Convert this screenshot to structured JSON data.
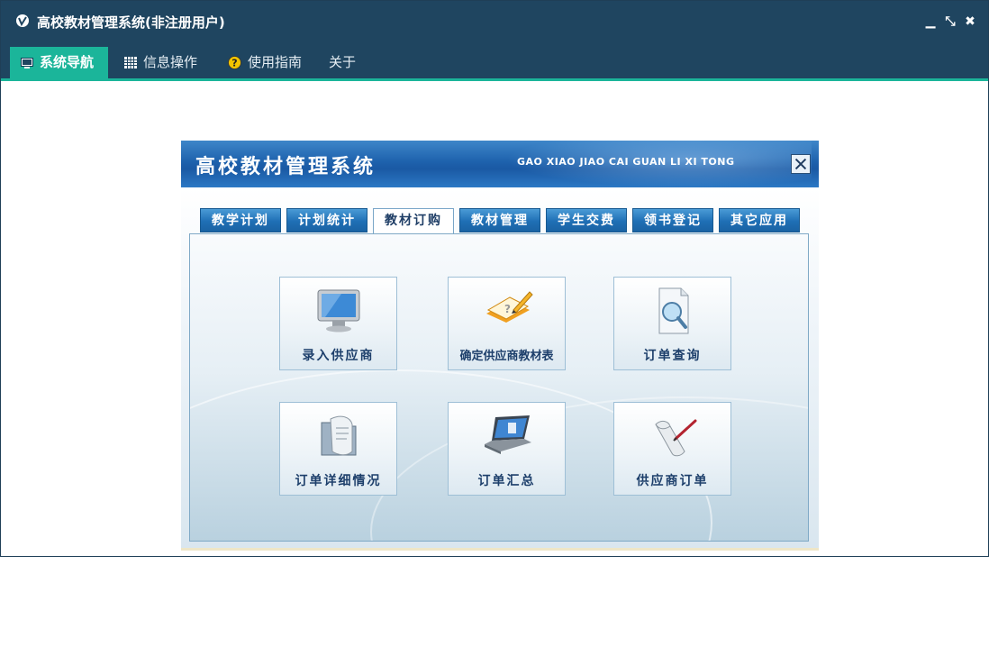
{
  "window": {
    "title": "高校教材管理系统(非注册用户)",
    "controls": {
      "minimize": "▁",
      "restore": "⤡",
      "close": "✖"
    }
  },
  "menubar": {
    "items": [
      {
        "label": "系统导航",
        "icon": "monitor-icon",
        "active": true
      },
      {
        "label": "信息操作",
        "icon": "grid-icon",
        "active": false
      },
      {
        "label": "使用指南",
        "icon": "help-icon",
        "active": false
      },
      {
        "label": "关于",
        "icon": "",
        "active": false
      }
    ]
  },
  "inner": {
    "title": "高校教材管理系统",
    "subtitle": "GAO XIAO JIAO CAI GUAN LI XI TONG",
    "tabs": [
      {
        "label": "教学计划",
        "active": false
      },
      {
        "label": "计划统计",
        "active": false
      },
      {
        "label": "教材订购",
        "active": true
      },
      {
        "label": "教材管理",
        "active": false
      },
      {
        "label": "学生交费",
        "active": false
      },
      {
        "label": "领书登记",
        "active": false
      },
      {
        "label": "其它应用",
        "active": false
      }
    ],
    "buttons": [
      {
        "label": "录入供应商",
        "icon": "monitor-icon"
      },
      {
        "label": "确定供应商教材表",
        "icon": "book-pencil-icon"
      },
      {
        "label": "订单查询",
        "icon": "document-search-icon"
      },
      {
        "label": "订单详细情况",
        "icon": "folder-scroll-icon"
      },
      {
        "label": "订单汇总",
        "icon": "laptop-icon"
      },
      {
        "label": "供应商订单",
        "icon": "scroll-pen-icon"
      }
    ]
  },
  "colors": {
    "titlebar": "#1f4560",
    "accent": "#1bb59a",
    "inner_header": "#1e62ad",
    "button_text": "#1d3f6b"
  }
}
